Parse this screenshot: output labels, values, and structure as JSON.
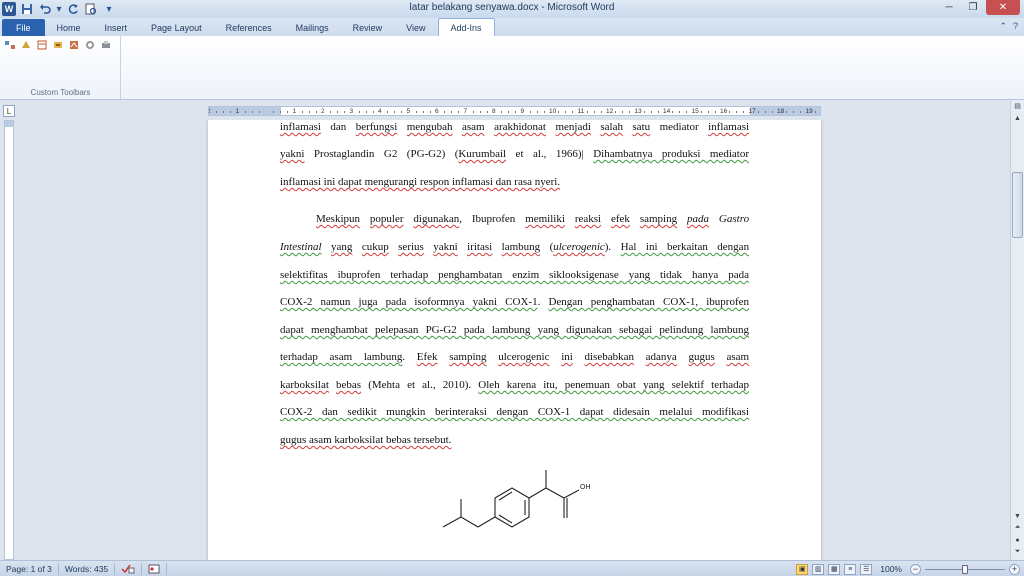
{
  "window": {
    "title": "latar belakang senyawa.docx - Microsoft Word",
    "app_icon_text": "W",
    "minimize_glyph": "─",
    "maximize_glyph": "❐",
    "close_glyph": "✕"
  },
  "quick_access": {
    "icons": [
      "save-icon",
      "undo-icon",
      "undo-dropdown-icon",
      "redo-icon",
      "print-preview-icon",
      "customize-qat-icon"
    ]
  },
  "tabs": [
    {
      "label": "File",
      "kind": "file"
    },
    {
      "label": "Home",
      "kind": "normal"
    },
    {
      "label": "Insert",
      "kind": "normal"
    },
    {
      "label": "Page Layout",
      "kind": "normal"
    },
    {
      "label": "References",
      "kind": "normal"
    },
    {
      "label": "Mailings",
      "kind": "normal"
    },
    {
      "label": "Review",
      "kind": "normal"
    },
    {
      "label": "View",
      "kind": "normal"
    },
    {
      "label": "Add-Ins",
      "kind": "active"
    }
  ],
  "ribbon": {
    "group_label": "Custom Toolbars",
    "toolbar_icons": [
      "toolbar-icon-1",
      "toolbar-icon-2",
      "toolbar-icon-3",
      "toolbar-icon-4",
      "toolbar-icon-5",
      "toolbar-icon-6",
      "toolbar-icon-7"
    ]
  },
  "ruler": {
    "numbers": [
      "2",
      "1",
      "",
      "1",
      "2",
      "3",
      "4",
      "5",
      "6",
      "7",
      "8",
      "9",
      "10",
      "11",
      "12",
      "13",
      "14",
      "15",
      "16",
      "17",
      "18",
      "19"
    ]
  },
  "document": {
    "lines": [
      [
        {
          "t": "inflamasi",
          "u": "s"
        },
        {
          "t": " dan "
        },
        {
          "t": "berfungsi",
          "u": "s"
        },
        {
          "t": " "
        },
        {
          "t": "mengubah",
          "u": "s"
        },
        {
          "t": " "
        },
        {
          "t": "asam",
          "u": "s"
        },
        {
          "t": " "
        },
        {
          "t": "arakhidonat",
          "u": "s"
        },
        {
          "t": " "
        },
        {
          "t": "menjadi",
          "u": "s"
        },
        {
          "t": " "
        },
        {
          "t": "salah",
          "u": "s"
        },
        {
          "t": " "
        },
        {
          "t": "satu",
          "u": "s"
        },
        {
          "t": " mediator "
        },
        {
          "t": "inflamasi",
          "u": "s"
        }
      ],
      [
        {
          "t": "yakni",
          "u": "s"
        },
        {
          "t": " Prostaglandin G2 (PG-G2) ("
        },
        {
          "t": "Kurumbail",
          "u": "s"
        },
        {
          "t": " et al., 1966)| "
        },
        {
          "t": "Dihambatnya produksi mediator",
          "u": "g"
        }
      ],
      [
        {
          "t": "inflamasi ini dapat mengurangi respon inflamasi  dan rasa nyeri.",
          "u": "s"
        }
      ],
      [
        {
          "t": "Meskipun",
          "u": "s"
        },
        {
          "t": " "
        },
        {
          "t": "populer",
          "u": "s"
        },
        {
          "t": " "
        },
        {
          "t": "digunakan",
          "u": "s"
        },
        {
          "t": ", Ibuprofen "
        },
        {
          "t": "memiliki",
          "u": "s"
        },
        {
          "t": " "
        },
        {
          "t": "reaksi",
          "u": "s"
        },
        {
          "t": " "
        },
        {
          "t": "efek",
          "u": "s"
        },
        {
          "t": " "
        },
        {
          "t": "samping",
          "u": "s"
        },
        {
          "t": " "
        },
        {
          "t": "pada",
          "i": true,
          "u": "s"
        },
        {
          "t": " Gastro",
          "i": true
        }
      ],
      [
        {
          "t": "Intestinal",
          "i": true,
          "u": "g"
        },
        {
          "t": "   "
        },
        {
          "t": "yang",
          "u": "s"
        },
        {
          "t": " "
        },
        {
          "t": "cukup",
          "u": "s"
        },
        {
          "t": " "
        },
        {
          "t": "serius",
          "u": "s"
        },
        {
          "t": " "
        },
        {
          "t": "yakni",
          "u": "s"
        },
        {
          "t": " "
        },
        {
          "t": "iritasi",
          "u": "s"
        },
        {
          "t": " "
        },
        {
          "t": "lambung",
          "u": "s"
        },
        {
          "t": " ("
        },
        {
          "t": "ulcerogenic",
          "i": true,
          "u": "s"
        },
        {
          "t": "). "
        },
        {
          "t": "Hal ini berkaitan dengan",
          "u": "g"
        }
      ],
      [
        {
          "t": "selektifitas ibuprofen terhadap penghambatan enzim siklooksigenase yang tidak hanya pada",
          "u": "g"
        }
      ],
      [
        {
          "t": "COX-2 namun juga pada isoformnya yakni COX-1",
          "u": "g"
        },
        {
          "t": ". "
        },
        {
          "t": "Dengan penghambatan COX-1, ibuprofen",
          "u": "g"
        }
      ],
      [
        {
          "t": "dapat menghambat pelepasan PG-G2 pada lambung yang digunakan sebagai pelindung lambung",
          "u": "g"
        }
      ],
      [
        {
          "t": "terhadap asam lambung",
          "u": "g"
        },
        {
          "t": ". "
        },
        {
          "t": "Efek",
          "u": "s"
        },
        {
          "t": " "
        },
        {
          "t": "samping",
          "u": "s"
        },
        {
          "t": " "
        },
        {
          "t": "ulcerogenic",
          "u": "s"
        },
        {
          "t": " "
        },
        {
          "t": "ini",
          "u": "s"
        },
        {
          "t": " "
        },
        {
          "t": "disebabkan",
          "u": "s"
        },
        {
          "t": " "
        },
        {
          "t": "adanya",
          "u": "s"
        },
        {
          "t": " "
        },
        {
          "t": "gugus",
          "u": "s"
        },
        {
          "t": " "
        },
        {
          "t": "asam",
          "u": "s"
        }
      ],
      [
        {
          "t": "karboksilat",
          "u": "s"
        },
        {
          "t": " "
        },
        {
          "t": "bebas",
          "u": "s"
        },
        {
          "t": " (Mehta et al., 2010). "
        },
        {
          "t": "Oleh karena itu, penemuan obat yang selektif terhadap",
          "u": "g"
        }
      ],
      [
        {
          "t": "COX-2 dan sedikit mungkin berinteraksi dengan COX-1 dapat didesain melalui modifikasi",
          "u": "g"
        }
      ],
      [
        {
          "t": "gugus asam karboksilat bebas tersebut.",
          "u": "s"
        }
      ]
    ],
    "molecule_label": "OH"
  },
  "status": {
    "page": "Page: 1 of 3",
    "words": "Words: 435",
    "zoom": "100%",
    "zoom_level_percent": 100,
    "zoom_out": "−",
    "zoom_in": "+"
  }
}
